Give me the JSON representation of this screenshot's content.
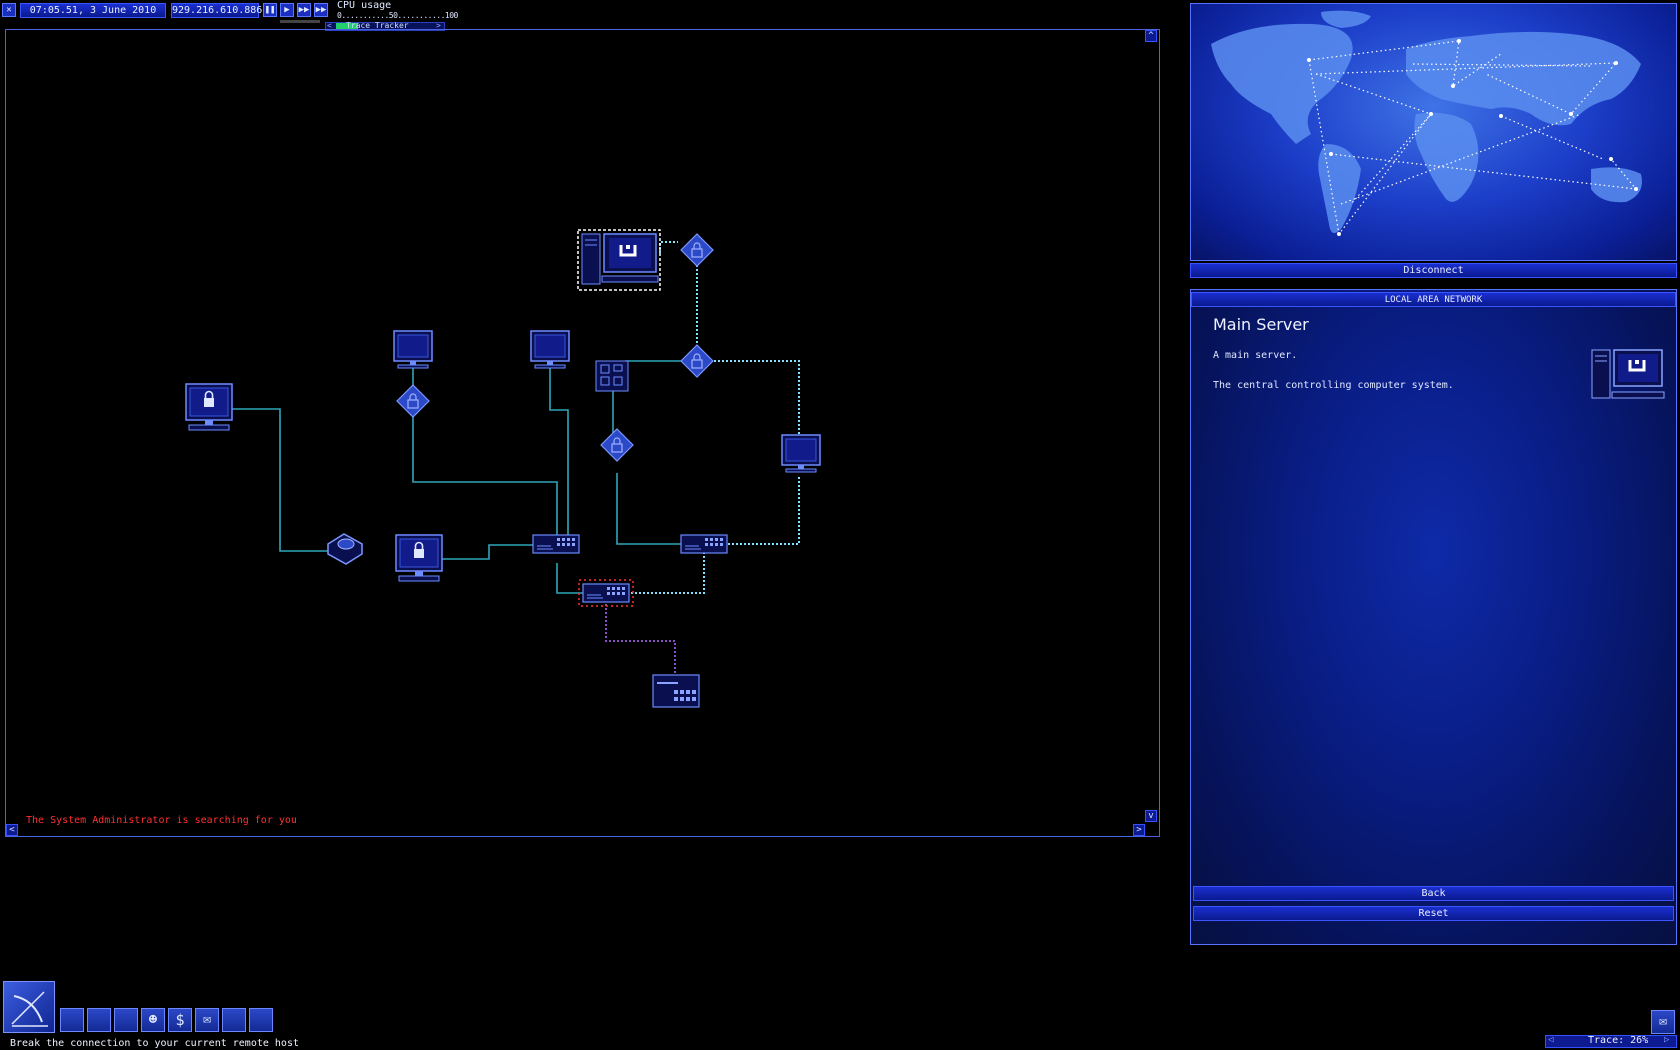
{
  "topbar": {
    "datetime": "07:05.51, 3 June 2010",
    "ip": "929.216.610.886",
    "cpu_label": "CPU usage",
    "cpu_scale": "0...........50...........100",
    "tracker_label": "Trace Tracker",
    "speed_buttons": [
      "pause-icon",
      "play-icon",
      "fast-forward-icon",
      "fastest-forward-icon"
    ]
  },
  "lan": {
    "message": "The System Administrator is searching for you",
    "nav_up": "^",
    "nav_down": "v",
    "nav_left": "<",
    "nav_right": ">"
  },
  "worldmap": {
    "disconnect_label": "Disconnect"
  },
  "info": {
    "header": "LOCAL AREA NETWORK",
    "title": "Main Server",
    "line1": "A main server.",
    "line2": "The central controlling computer system.",
    "back_label": "Back",
    "reset_label": "Reset"
  },
  "status": {
    "hint": "Break the connection to your current remote host",
    "trace": "Trace: 26%"
  },
  "colors": {
    "accent": "#1a2fd0",
    "link": "#2fa6b8",
    "active_link": "#9fe8ff",
    "alert": "#ff3030"
  },
  "taskbar_icons": [
    "gateway-icon",
    "memory-icon",
    "disk-icon",
    "person-icon",
    "finance-icon",
    "email-icon",
    "network-icon",
    "map-icon"
  ]
}
